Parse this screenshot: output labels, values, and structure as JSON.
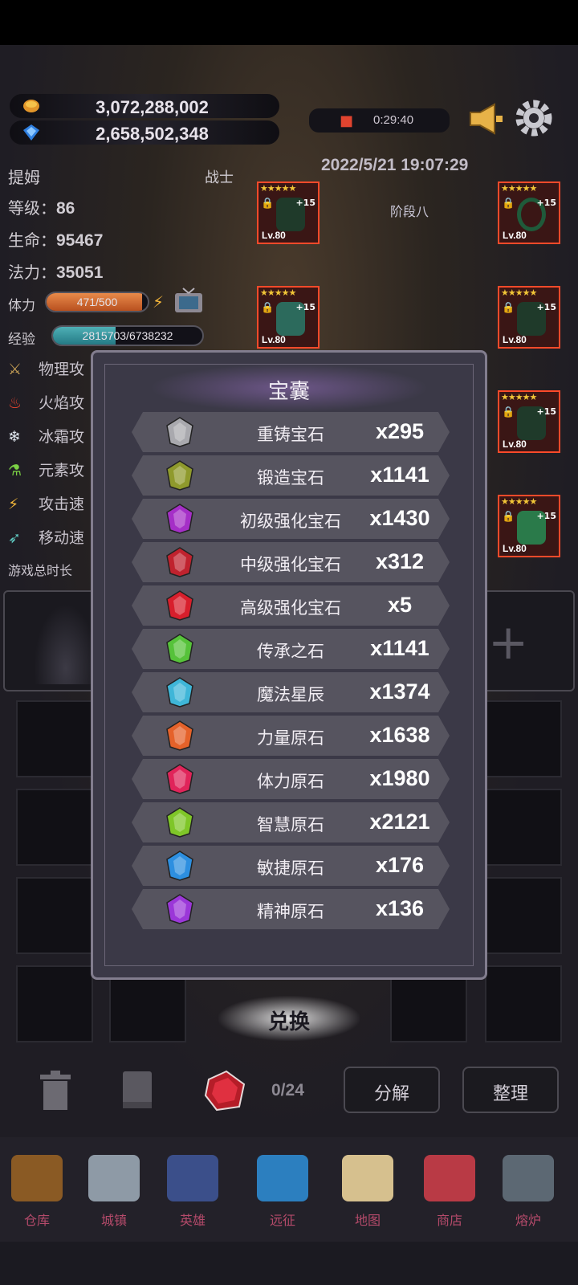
{
  "header": {
    "gold": "3,072,288,002",
    "gems": "2,658,502,348",
    "timer": "0:29:40",
    "datetime": "2022/5/21 19:07:29"
  },
  "hero": {
    "name": "提姆",
    "class": "战士",
    "stage": "阶段八",
    "level_label": "等级：",
    "level": "86",
    "hp_label": "生命：",
    "hp": "95467",
    "mp_label": "法力：",
    "mp": "35051",
    "stamina_label": "体力",
    "stamina": "471/500",
    "stamina_ratio": 0.942,
    "exp_label": "经验",
    "exp": "2815703/6738232",
    "exp_ratio": 0.418
  },
  "side_stats": [
    "物理攻",
    "火焰攻",
    "冰霜攻",
    "元素攻",
    "攻击速",
    "移动速"
  ],
  "playtime_label": "游戏总时长",
  "equipment": [
    {
      "level": "Lv.80",
      "enh": "+15",
      "stars": "★★★★★"
    },
    {
      "level": "Lv.80",
      "enh": "+15",
      "stars": "★★★★★"
    },
    {
      "level": "Lv.80",
      "enh": "+15",
      "stars": "★★★★★"
    },
    {
      "level": "Lv.80",
      "enh": "+15",
      "stars": "★★★★★"
    },
    {
      "level": "Lv.80",
      "enh": "+15",
      "stars": "★★★★★"
    },
    {
      "level": "Lv.80",
      "enh": "+15",
      "stars": "★★★★★"
    }
  ],
  "bag": {
    "title": "宝囊",
    "items": [
      {
        "name": "重铸宝石",
        "qty": "x295",
        "color": "#a9a9ae"
      },
      {
        "name": "锻造宝石",
        "qty": "x1141",
        "color": "#8f9a2c"
      },
      {
        "name": "初级强化宝石",
        "qty": "x1430",
        "color": "#a52fc7"
      },
      {
        "name": "中级强化宝石",
        "qty": "x312",
        "color": "#c0222e"
      },
      {
        "name": "高级强化宝石",
        "qty": "x5",
        "color": "#d81f2c"
      },
      {
        "name": "传承之石",
        "qty": "x1141",
        "color": "#56c23a"
      },
      {
        "name": "魔法星辰",
        "qty": "x1374",
        "color": "#3fb6d8"
      },
      {
        "name": "力量原石",
        "qty": "x1638",
        "color": "#e5622a"
      },
      {
        "name": "体力原石",
        "qty": "x1980",
        "color": "#e0245a"
      },
      {
        "name": "智慧原石",
        "qty": "x2121",
        "color": "#7fc628"
      },
      {
        "name": "敏捷原石",
        "qty": "x176",
        "color": "#2d8fe0"
      },
      {
        "name": "精神原石",
        "qty": "x136",
        "color": "#9b37d8"
      }
    ],
    "exchange_label": "兑换"
  },
  "inventory": {
    "count": "0/24",
    "decompose_label": "分解",
    "sort_label": "整理"
  },
  "nav": [
    {
      "label": "仓库",
      "color": "#8a5a24"
    },
    {
      "label": "城镇",
      "color": "#8e9aa6"
    },
    {
      "label": "英雄",
      "color": "#3b4f8a"
    },
    {
      "label": "远征",
      "color": "#2c7fbf"
    },
    {
      "label": "地图",
      "color": "#d6c08e"
    },
    {
      "label": "商店",
      "color": "#b93a45"
    },
    {
      "label": "熔炉",
      "color": "#5c6873"
    }
  ]
}
